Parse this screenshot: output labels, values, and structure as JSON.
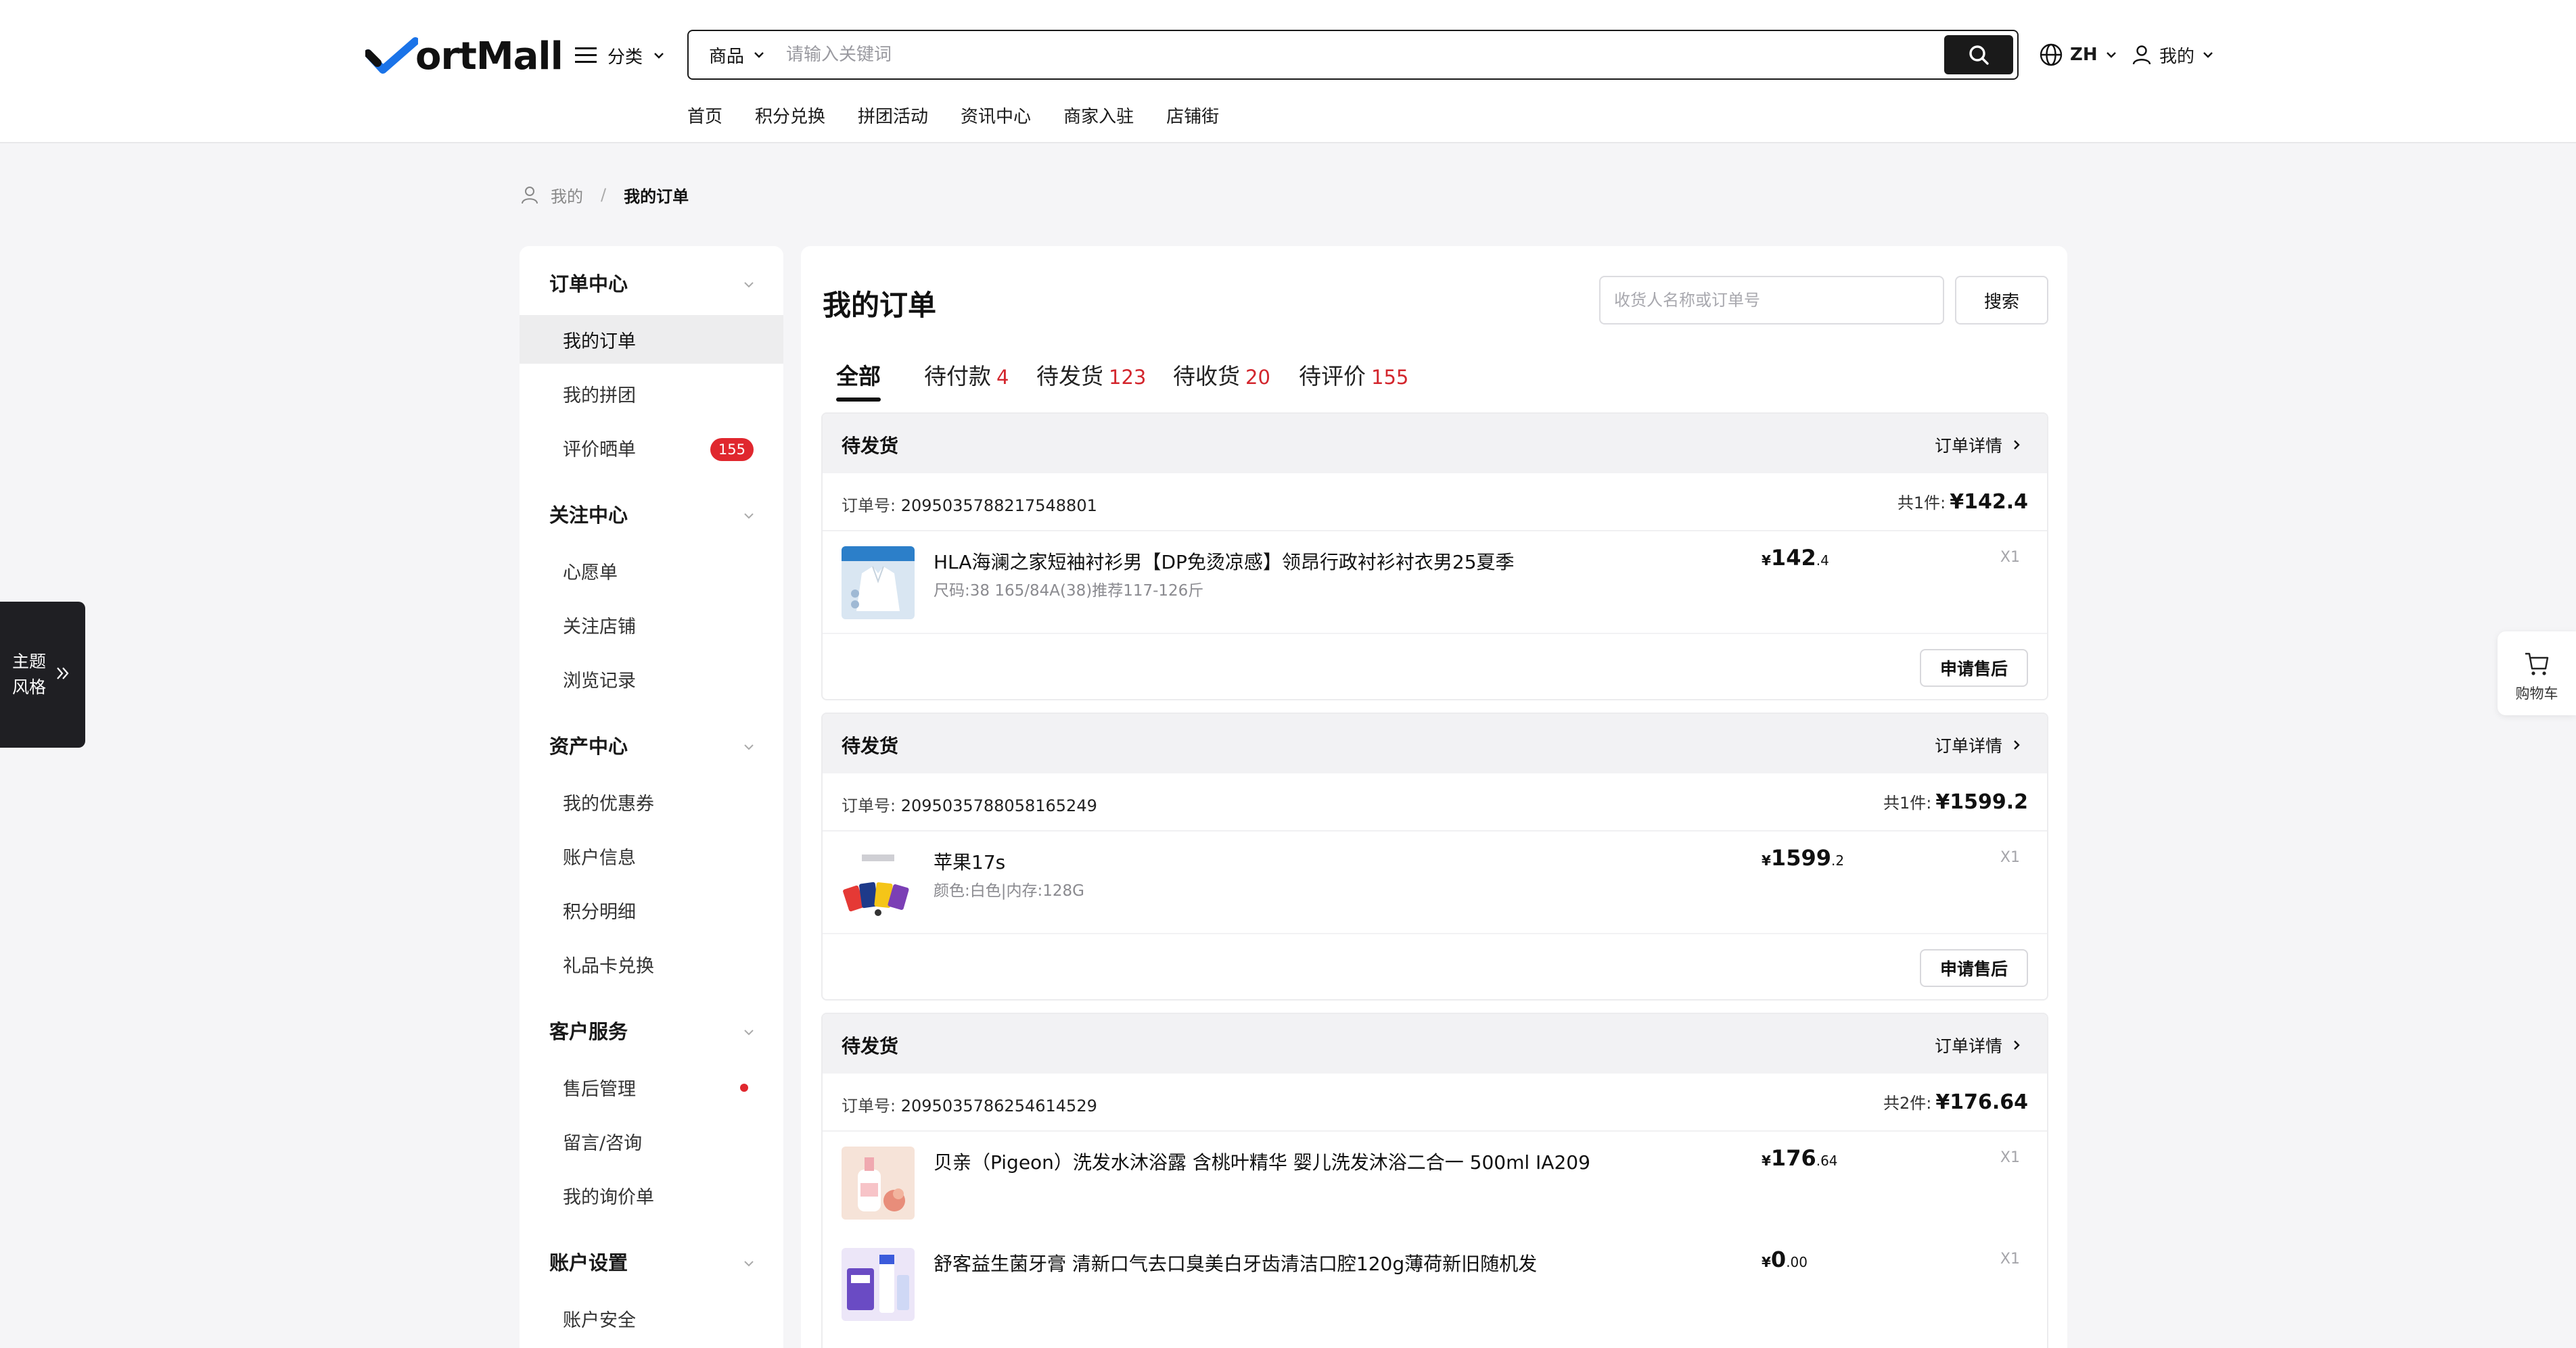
{
  "header": {
    "logo_text": "ortMall",
    "category_label": "分类",
    "search_scope": "商品",
    "search_placeholder": "请输入关键词",
    "language": "ZH",
    "account_label": "我的",
    "nav": [
      "首页",
      "积分兑换",
      "拼团活动",
      "资讯中心",
      "商家入驻",
      "店铺街"
    ]
  },
  "breadcrumb": {
    "home": "我的",
    "separator": "/",
    "current": "我的订单"
  },
  "sidebar": {
    "groups": [
      {
        "title": "订单中心",
        "items": [
          {
            "label": "我的订单",
            "active": true
          },
          {
            "label": "我的拼团"
          },
          {
            "label": "评价晒单",
            "badge": "155"
          }
        ]
      },
      {
        "title": "关注中心",
        "items": [
          {
            "label": "心愿单"
          },
          {
            "label": "关注店铺"
          },
          {
            "label": "浏览记录"
          }
        ]
      },
      {
        "title": "资产中心",
        "items": [
          {
            "label": "我的优惠券"
          },
          {
            "label": "账户信息"
          },
          {
            "label": "积分明细"
          },
          {
            "label": "礼品卡兑换"
          }
        ]
      },
      {
        "title": "客户服务",
        "items": [
          {
            "label": "售后管理",
            "dot": true
          },
          {
            "label": "留言/咨询"
          },
          {
            "label": "我的询价单"
          }
        ]
      },
      {
        "title": "账户设置",
        "items": [
          {
            "label": "账户安全"
          }
        ]
      }
    ]
  },
  "main": {
    "title": "我的订单",
    "search_placeholder": "收货人名称或订单号",
    "search_button": "搜索",
    "tabs": [
      {
        "label": "全部",
        "count": "",
        "active": true
      },
      {
        "label": "待付款",
        "count": "4"
      },
      {
        "label": "待发货",
        "count": "123"
      },
      {
        "label": "待收货",
        "count": "20"
      },
      {
        "label": "待评价",
        "count": "155"
      }
    ],
    "orders": [
      {
        "status": "待发货",
        "detail_label": "订单详情",
        "order_no_label": "订单号:",
        "order_no": "2095035788217548801",
        "total_label": "共1件:",
        "total": "¥142.4",
        "items": [
          {
            "name": "HLA海澜之家短袖衬衫男【DP免烫凉感】领昂行政衬衫衬衣男25夏季",
            "spec": "尺码:38 165/84A(38)推荐117-126斤",
            "price_symbol": "¥",
            "price_int": "142",
            "price_dec": ".4",
            "qty": "X1",
            "thumb": "shirt"
          }
        ],
        "action": "申请售后"
      },
      {
        "status": "待发货",
        "detail_label": "订单详情",
        "order_no_label": "订单号:",
        "order_no": "2095035788058165249",
        "total_label": "共1件:",
        "total": "¥1599.2",
        "items": [
          {
            "name": "苹果17s",
            "spec": "颜色:白色|内存:128G",
            "price_symbol": "¥",
            "price_int": "1599",
            "price_dec": ".2",
            "qty": "X1",
            "thumb": "phones"
          }
        ],
        "action": "申请售后"
      },
      {
        "status": "待发货",
        "detail_label": "订单详情",
        "order_no_label": "订单号:",
        "order_no": "2095035786254614529",
        "total_label": "共2件:",
        "total": "¥176.64",
        "items": [
          {
            "name": "贝亲（Pigeon）洗发水沐浴露 含桃叶精华 婴儿洗发沐浴二合一 500ml IA209",
            "spec": "",
            "price_symbol": "¥",
            "price_int": "176",
            "price_dec": ".64",
            "qty": "X1",
            "thumb": "bottle"
          },
          {
            "name": "舒客益生菌牙膏 清新口气去口臭美白牙齿清洁口腔120g薄荷新旧随机发",
            "spec": "",
            "price_symbol": "¥",
            "price_int": "0",
            "price_dec": ".00",
            "qty": "X1",
            "thumb": "toothpaste"
          }
        ],
        "action": ""
      }
    ]
  },
  "floating": {
    "theme_line1": "主题",
    "theme_line2": "风格",
    "cart_label": "购物车"
  },
  "colors": {
    "accent": "#1a1a1a",
    "badge": "#e0272e",
    "count": "#d3262d",
    "logo_blue": "#1a73e8"
  }
}
